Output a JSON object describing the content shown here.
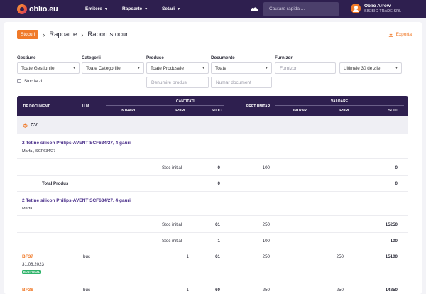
{
  "app": {
    "logo_text": "oblio.eu"
  },
  "nav": {
    "items": [
      {
        "label": "Emitere"
      },
      {
        "label": "Rapoarte"
      },
      {
        "label": "Setari"
      }
    ],
    "search_placeholder": "Cautare rapida ...",
    "user_name": "Oblio Arrow",
    "user_company": "SIS BIO TRADE SRL"
  },
  "breadcrumb": {
    "badge": "Stocuri",
    "items": [
      "Rapoarte",
      "Raport stocuri"
    ]
  },
  "export_label": "Exporta",
  "filters": {
    "gestiune": {
      "label": "Gestiune",
      "value": "Toate Gestiunile"
    },
    "categorii": {
      "label": "Categorii",
      "value": "Toate Categoriile"
    },
    "produse": {
      "label": "Produse",
      "value": "Toate Produsele"
    },
    "documente": {
      "label": "Documente",
      "value": "Toate"
    },
    "furnizor": {
      "label": "Furnizor",
      "placeholder": "Furnizor"
    },
    "perioada": {
      "value": "Ultimele 30 de zile"
    },
    "denumire_placeholder": "Denumire produs",
    "numar_placeholder": "Numar document",
    "stoc_la_zi": "Stoc la zi"
  },
  "table": {
    "headers": {
      "tip_document": "TIP DOCUMENT",
      "um": "U.M.",
      "cantitati": "CANTITATI",
      "intrari": "INTRARI",
      "iesiri": "IESIRI",
      "stoc": "STOC",
      "pret_unitar": "PRET UNITAR",
      "valoare": "VALOARE",
      "v_intrari": "INTRARI",
      "v_iesiri": "IESIRI",
      "sold": "SOLD"
    },
    "group": "CV",
    "product1": {
      "title": "2 Tetine silicon Philips-AVENT SCF634/27, 4 gauri",
      "sub": "Marfa , SCF634/27",
      "row": {
        "label": "Stoc initial",
        "stoc": "0",
        "pret": "100",
        "sold": "0"
      },
      "total": {
        "label": "Total Produs",
        "stoc": "0",
        "sold": "0"
      }
    },
    "product2": {
      "title": "2 Tetine silicon Philips-AVENT SCF634/27, 4 gauri",
      "sub": "Marfa",
      "rows": [
        {
          "label": "Stoc initial",
          "stoc": "61",
          "pret": "250",
          "sold": "15250"
        },
        {
          "label": "Stoc initial",
          "stoc": "1",
          "pret": "100",
          "sold": "100"
        }
      ]
    },
    "docs": [
      {
        "doc": "BF37",
        "date": "31.08.2023",
        "badge": "BON FISCAL",
        "um": "buc",
        "iesiri": "1",
        "stoc": "61",
        "pret": "250",
        "v_iesiri": "250",
        "sold": "15100"
      },
      {
        "doc": "BF38",
        "um": "buc",
        "iesiri": "1",
        "stoc": "60",
        "pret": "250",
        "v_iesiri": "250",
        "sold": "14850"
      }
    ]
  }
}
